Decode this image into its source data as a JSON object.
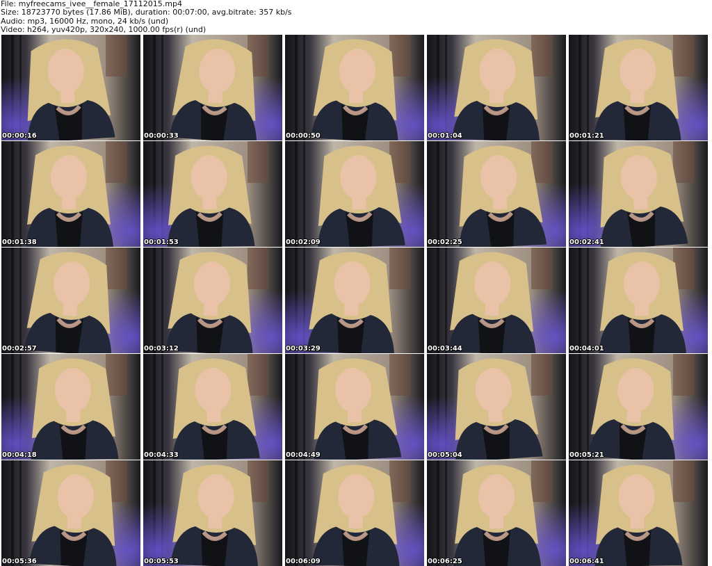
{
  "header": {
    "file_line": "File: myfreecams_ivee__female_17112015.mp4",
    "size_line": "Size: 18723770 bytes (17.86 MiB), duration: 00:07:00, avg.bitrate: 357 kb/s",
    "audio_line": "Audio: mp3, 16000 Hz, mono, 24 kb/s (und)",
    "video_line": "Video: h264, yuv420p, 320x240, 1000.00 fps(r) (und)"
  },
  "thumbnails": [
    {
      "timestamp": "00:00:16"
    },
    {
      "timestamp": "00:00:33"
    },
    {
      "timestamp": "00:00:50"
    },
    {
      "timestamp": "00:01:04"
    },
    {
      "timestamp": "00:01:21"
    },
    {
      "timestamp": "00:01:38"
    },
    {
      "timestamp": "00:01:53"
    },
    {
      "timestamp": "00:02:09"
    },
    {
      "timestamp": "00:02:25"
    },
    {
      "timestamp": "00:02:41"
    },
    {
      "timestamp": "00:02:57"
    },
    {
      "timestamp": "00:03:12"
    },
    {
      "timestamp": "00:03:29"
    },
    {
      "timestamp": "00:03:44"
    },
    {
      "timestamp": "00:04:01"
    },
    {
      "timestamp": "00:04:18"
    },
    {
      "timestamp": "00:04:33"
    },
    {
      "timestamp": "00:04:49"
    },
    {
      "timestamp": "00:05:04"
    },
    {
      "timestamp": "00:05:21"
    },
    {
      "timestamp": "00:05:36"
    },
    {
      "timestamp": "00:05:53"
    },
    {
      "timestamp": "00:06:09"
    },
    {
      "timestamp": "00:06:25"
    },
    {
      "timestamp": "00:06:41"
    }
  ],
  "colors": {
    "background": "#ffffff",
    "header_text": "#111111",
    "timestamp_text": "#ffffff",
    "hair": "#d8c08a",
    "skin": "#e9c2a8",
    "vest": "#232838",
    "wall_light": "#bfb6a8",
    "shadow": "#141418",
    "purple_glow": "#6a55d8"
  }
}
